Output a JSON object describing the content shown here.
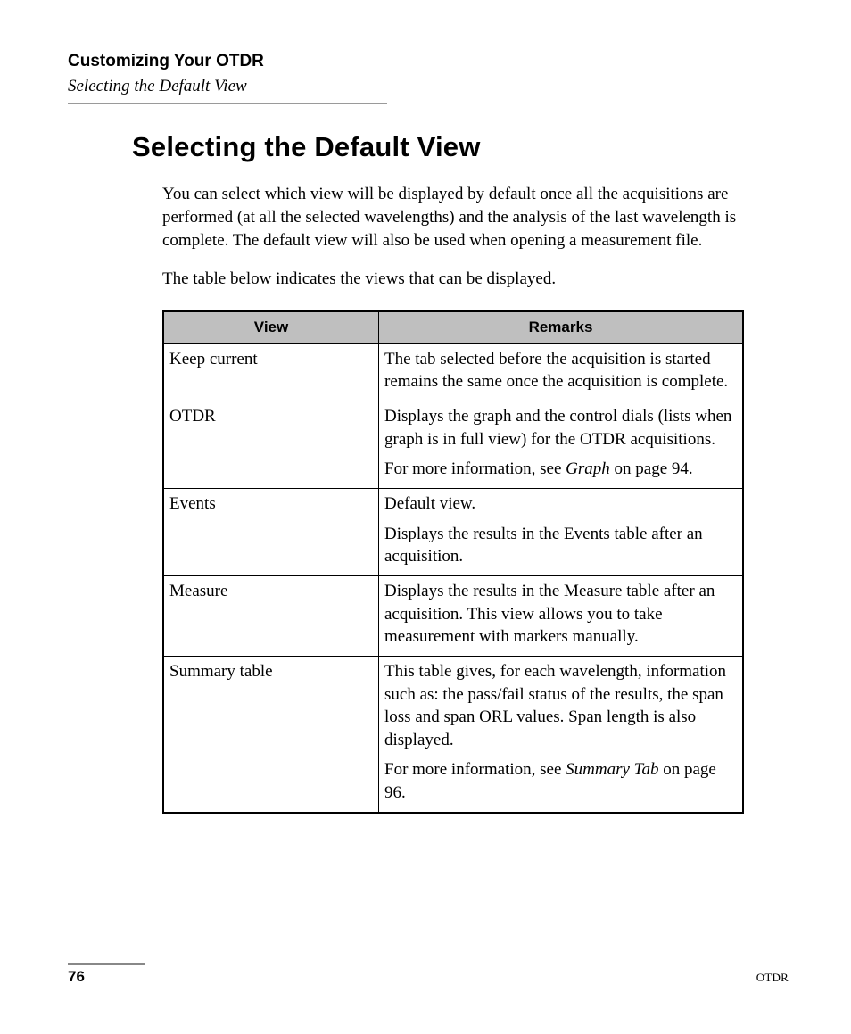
{
  "header": {
    "chapter_title": "Customizing Your OTDR",
    "section_title": "Selecting the Default View"
  },
  "heading": "Selecting the Default View",
  "paragraphs": {
    "p1": "You can select which view will be displayed by default once all the acquisitions are performed (at all the selected wavelengths) and the analysis of the last wavelength is complete. The default view will also be used when opening a measurement file.",
    "p2": "The table below indicates the views that can be displayed."
  },
  "table": {
    "headers": {
      "view": "View",
      "remarks": "Remarks"
    },
    "rows": [
      {
        "view": "Keep current",
        "remarks_plain": "The tab selected before the acquisition is started remains the same once the acquisition is complete."
      },
      {
        "view": "OTDR",
        "remarks_p1": "Displays the graph and the control dials (lists when graph is in full view) for the OTDR acquisitions.",
        "remarks_p2_pre": "For more information, see ",
        "remarks_p2_em": "Graph",
        "remarks_p2_post": " on page 94."
      },
      {
        "view": "Events",
        "remarks_p1": "Default view.",
        "remarks_p2": "Displays the results in the Events table after an acquisition."
      },
      {
        "view": "Measure",
        "remarks_plain": "Displays the results in the Measure table after an acquisition. This view allows you to take measurement with markers manually."
      },
      {
        "view": "Summary table",
        "remarks_p1": "This table gives, for each wavelength, information such as: the pass/fail status of the results, the span loss and span ORL values. Span length is also displayed.",
        "remarks_p2_pre": "For more information, see ",
        "remarks_p2_em": "Summary Tab",
        "remarks_p2_post": " on page 96."
      }
    ]
  },
  "footer": {
    "page_number": "76",
    "doc_short": "OTDR"
  }
}
